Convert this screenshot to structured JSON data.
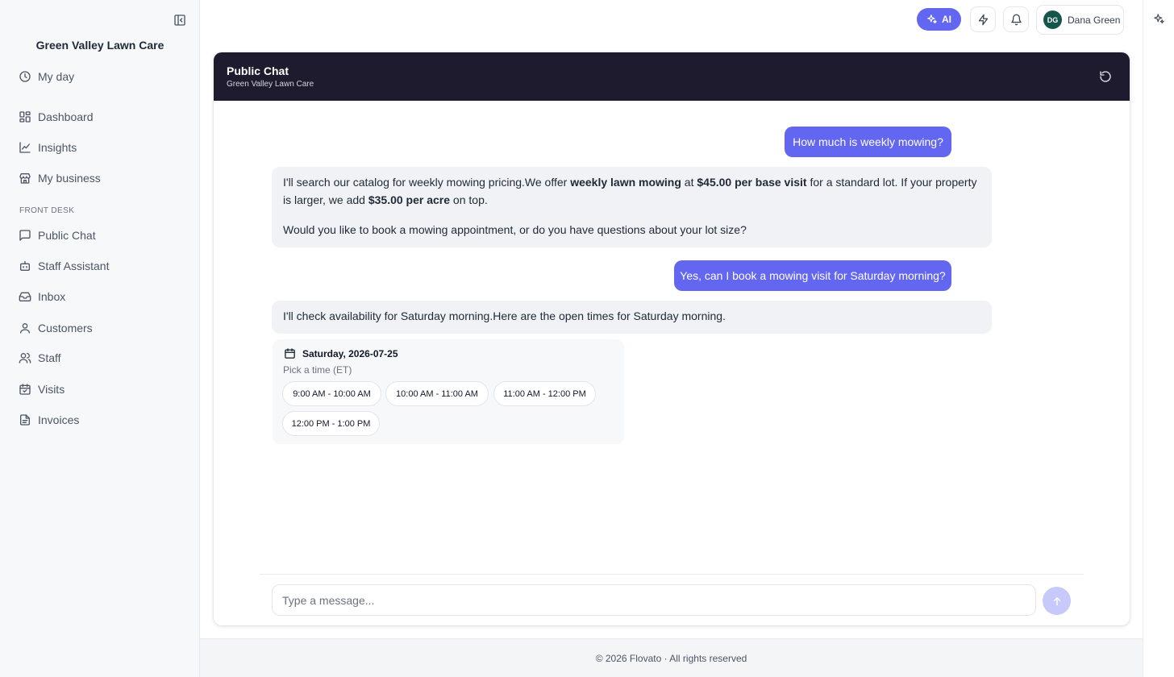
{
  "sidebar": {
    "brand": "Green Valley Lawn Care",
    "primary": [
      {
        "label": "My day",
        "icon": "clock-icon"
      },
      {
        "label": "Dashboard",
        "icon": "dashboard-icon"
      },
      {
        "label": "Insights",
        "icon": "chart-line-icon"
      },
      {
        "label": "My business",
        "icon": "store-icon"
      }
    ],
    "section_label": "FRONT DESK",
    "front_desk": [
      {
        "label": "Public Chat",
        "icon": "message-icon"
      },
      {
        "label": "Staff Assistant",
        "icon": "bot-icon"
      },
      {
        "label": "Inbox",
        "icon": "inbox-icon"
      },
      {
        "label": "Customers",
        "icon": "user-icon"
      },
      {
        "label": "Staff",
        "icon": "users-icon"
      },
      {
        "label": "Visits",
        "icon": "calendar-check-icon"
      },
      {
        "label": "Invoices",
        "icon": "document-icon"
      }
    ]
  },
  "topbar": {
    "ai_label": "AI",
    "user": {
      "initials": "DG",
      "name": "Dana Green"
    }
  },
  "chat": {
    "title": "Public Chat",
    "subtitle": "Green Valley Lawn Care",
    "messages": {
      "user1": "How much is weekly mowing?",
      "bot1": {
        "p1_a": "I'll search our catalog for weekly mowing pricing.We offer ",
        "p1_b": "weekly lawn mowing",
        "p1_c": " at ",
        "p1_d": "$45.00 per base visit",
        "p1_e": " for a standard lot. If your property is larger, we add ",
        "p1_f": "$35.00 per acre",
        "p1_g": " on top.",
        "p2": "Would you like to book a mowing appointment, or do you have questions about your lot size?"
      },
      "user2": "Yes, can I book a mowing visit for Saturday morning?",
      "bot2": "I'll check availability for Saturday morning.Here are the open times for Saturday morning."
    },
    "slots": {
      "date": "Saturday, 2026-07-25",
      "hint": "Pick a time (ET)",
      "times": [
        "9:00 AM - 10:00 AM",
        "10:00 AM - 11:00 AM",
        "11:00 AM - 12:00 PM",
        "12:00 PM - 1:00 PM"
      ]
    },
    "composer": {
      "placeholder": "Type a message..."
    }
  },
  "footer": {
    "text": "© 2026 Flovato · All rights reserved"
  },
  "colors": {
    "accent": "#6366f1",
    "header_bg": "#1e1b2e",
    "avatar_bg": "#14564a"
  }
}
